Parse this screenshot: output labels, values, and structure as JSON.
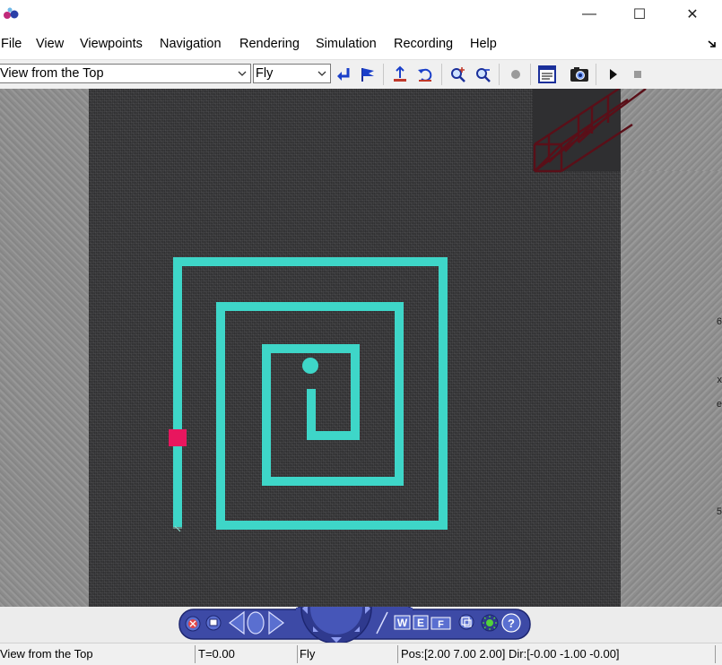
{
  "window": {
    "controls": {
      "minimize": "—",
      "maximize": "☐",
      "close": "✕"
    }
  },
  "menu": {
    "items": [
      "File",
      "View",
      "Viewpoints",
      "Navigation",
      "Rendering",
      "Simulation",
      "Recording",
      "Help"
    ]
  },
  "toolbar": {
    "viewpoint_value": "View from the Top",
    "navigation_mode_value": "Fly",
    "icons": [
      "return-icon",
      "flag-icon",
      "straighten-icon",
      "undo-move-icon",
      "zoom-in-icon",
      "zoom-out-icon",
      "record-dot-icon",
      "console-icon",
      "screenshot-camera-icon",
      "play-icon",
      "stop-icon"
    ]
  },
  "scene": {
    "path_color": "#3ed6c8",
    "robot_color": "#e8165e",
    "floor_color": "#3a3a3c",
    "wall_color": "#8f8f8f",
    "truss_color": "#5a0f18",
    "edge_marks": [
      "6",
      "x",
      "e",
      "5"
    ]
  },
  "navbar": {
    "buttons": [
      "close-nav-icon",
      "viewpoint-icon",
      "back-arrow-icon",
      "home-circle-icon",
      "forward-arrow-icon",
      "compass-wheel-icon",
      "w-key-button",
      "e-key-button",
      "f-key-button",
      "window-icon",
      "headlight-icon",
      "help-icon"
    ],
    "labels": {
      "w": "W",
      "e": "E",
      "f": "F",
      "help": "?"
    }
  },
  "status": {
    "viewpoint": "View from the Top",
    "time": "T=0.00",
    "mode": "Fly",
    "position": "Pos:[2.00 7.00 2.00] Dir:[-0.00 -1.00 -0.00]"
  }
}
